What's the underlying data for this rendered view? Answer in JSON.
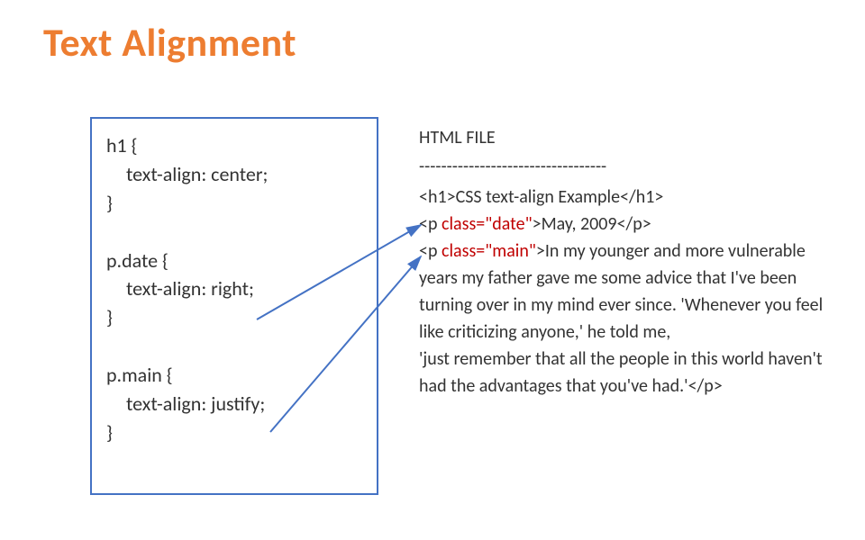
{
  "title": "Text Alignment",
  "css": {
    "rule1_sel": "h1 {",
    "rule1_prop": "text-align: center;",
    "rule1_close": "}",
    "rule2_sel": "p.date {",
    "rule2_prop": "text-align: right;",
    "rule2_close": "}",
    "rule3_sel": "p.main {",
    "rule3_prop": "text-align: justify;",
    "rule3_close": "}"
  },
  "html": {
    "header": "HTML FILE",
    "dashes": "----------------------------------",
    "h1_open": "<h1>",
    "h1_text": "CSS text-align Example",
    "h1_close": "</h1>",
    "p_open": "<p ",
    "date_attr": "class=\"date\"",
    "p_open_end": ">",
    "date_text": "May, 2009",
    "p_close": "</p>",
    "main_attr": "class=\"main\"",
    "main_text_a": "In my younger and more vulnerable years my father gave me some advice that I've been turning over in my mind ever since. 'Whenever you feel like criticizing anyone,' he told me,",
    "main_text_b": "'just remember that all the people in this world haven't had the advantages that you've had.'"
  }
}
